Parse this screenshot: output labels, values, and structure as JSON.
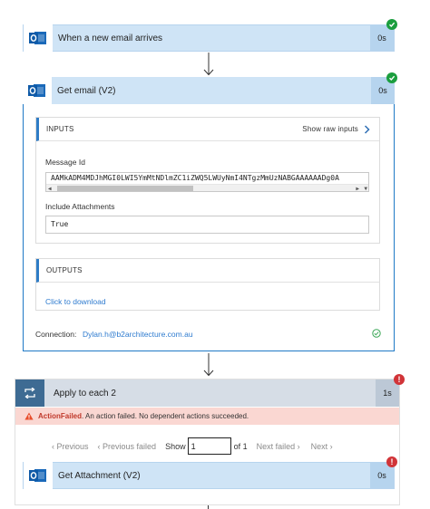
{
  "trigger": {
    "title": "When a new email arrives",
    "duration": "0s"
  },
  "get_email": {
    "title": "Get email (V2)",
    "duration": "0s",
    "inputs": {
      "heading": "INPUTS",
      "show_raw": "Show raw inputs",
      "message_id_label": "Message Id",
      "message_id_value": "AAMkADM4MDJhMGI0LWI5YmMtNDlmZC1iZWQ5LWUyNmI4NTgzMmUzNABGAAAAAADg0A",
      "include_attachments_label": "Include Attachments",
      "include_attachments_value": "True"
    },
    "outputs": {
      "heading": "OUTPUTS",
      "download_link": "Click to download"
    },
    "connection_label": "Connection:",
    "connection_value": "Dylan.h@b2architecture.com.au"
  },
  "apply_each": {
    "title": "Apply to each 2",
    "duration": "1s",
    "error_code": "ActionFailed",
    "error_message": ". An action failed. No dependent actions succeeded.",
    "pager": {
      "previous": "Previous",
      "previous_failed": "Previous failed",
      "show_label": "Show",
      "current_page": "1",
      "of_label": "of 1",
      "next_failed": "Next failed",
      "next": "Next"
    }
  },
  "get_attachment": {
    "title": "Get Attachment (V2)",
    "duration": "0s"
  },
  "colors": {
    "accent": "#1f79c6",
    "success": "#1b9e3e",
    "error": "#d13438"
  }
}
